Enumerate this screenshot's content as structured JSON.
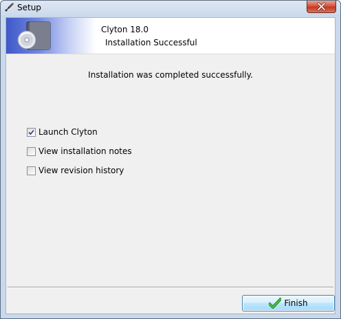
{
  "window": {
    "title": "Setup"
  },
  "header": {
    "product": "Clyton 18.0",
    "subtitle": "Installation Successful"
  },
  "main": {
    "message": "Installation was completed successfully.",
    "options": [
      {
        "label": "Launch Clyton",
        "checked": true
      },
      {
        "label": "View installation notes",
        "checked": false
      },
      {
        "label": "View revision history",
        "checked": false
      }
    ]
  },
  "footer": {
    "finish_label": "Finish"
  },
  "icons": {
    "app": "setup-icon",
    "close": "close-icon",
    "header": "disc-box-icon",
    "finish": "checkmark-icon"
  },
  "colors": {
    "header_gradient_start": "#3f58c8",
    "finish_check": "#2e9b2e",
    "close_button": "#c23a22"
  }
}
